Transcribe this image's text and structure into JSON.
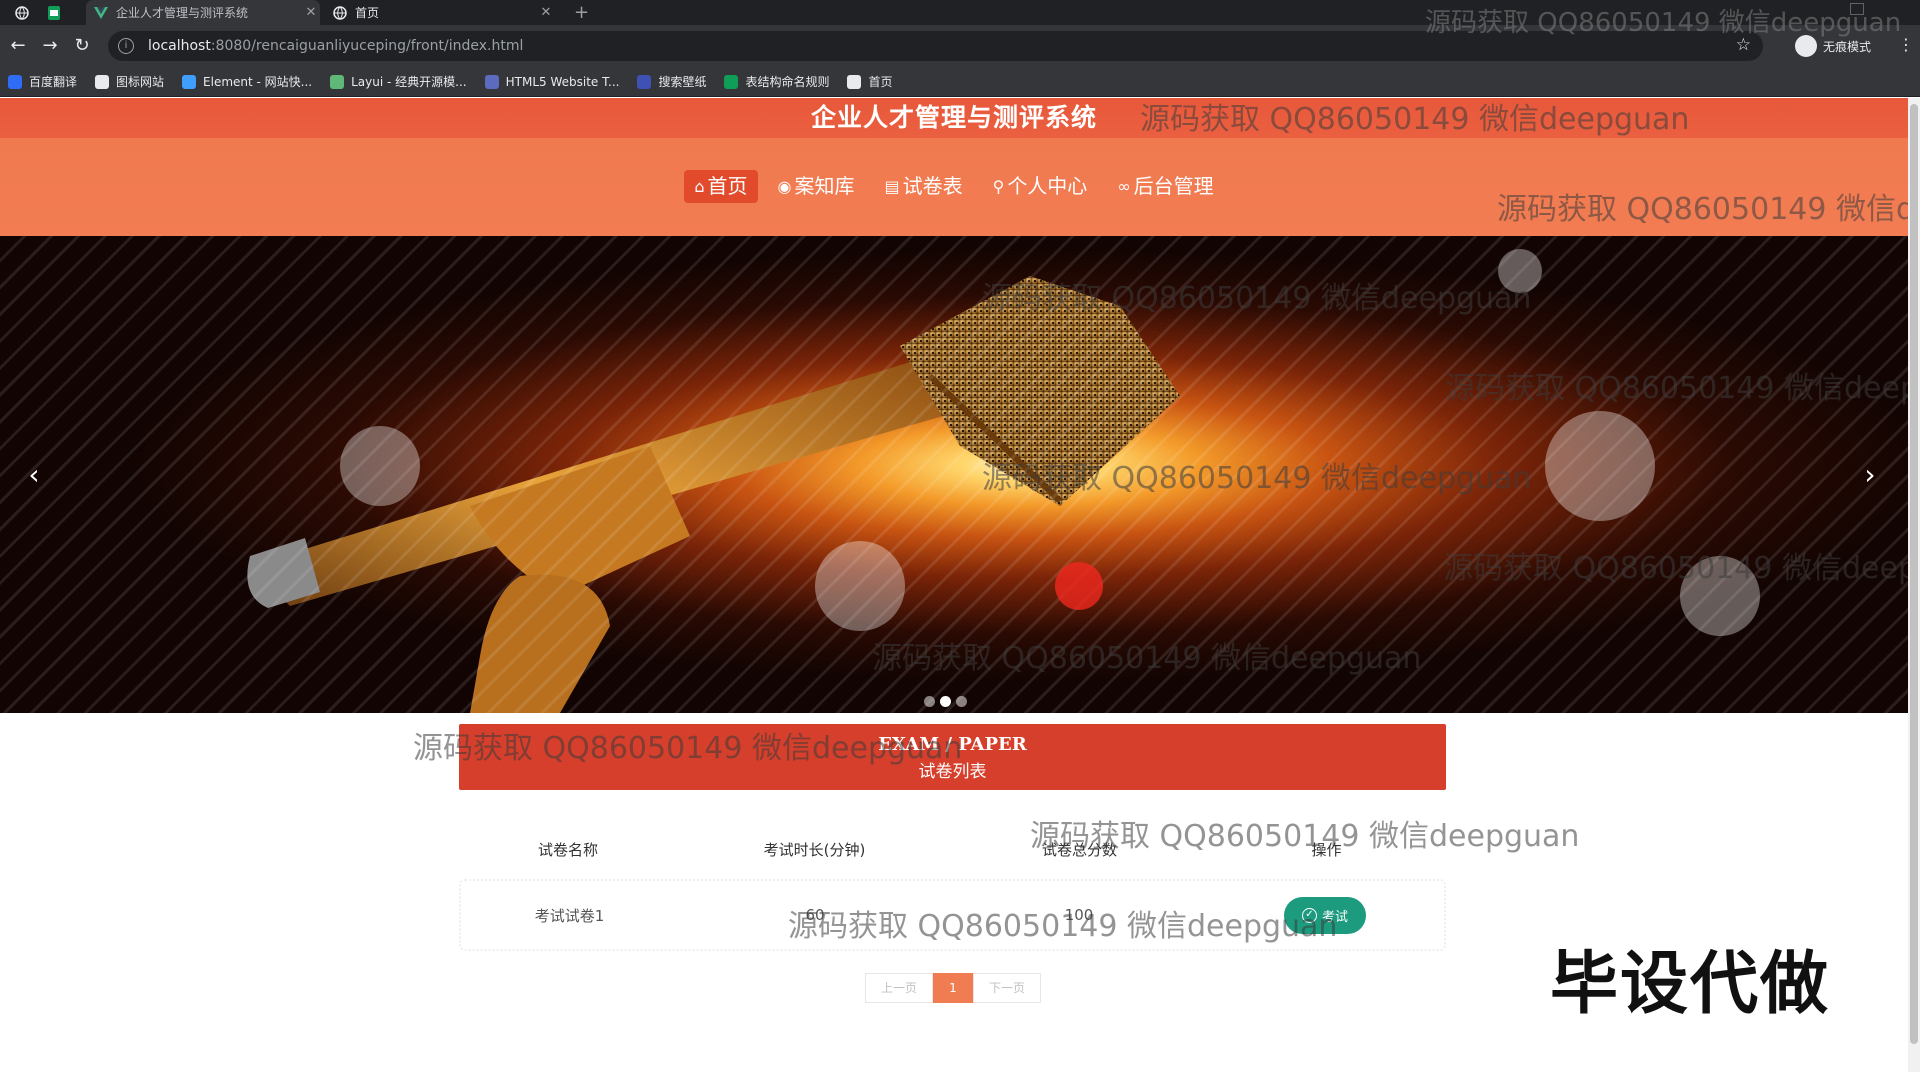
{
  "browser": {
    "tabs": [
      {
        "label": ""
      },
      {
        "label": ""
      },
      {
        "label": "企业人才管理与测评系统"
      },
      {
        "label": "首页"
      }
    ],
    "url_host": "localhost",
    "url_path": ":8080/rencaiguanliyuceping/front/index.html",
    "incognito_label": "无痕模式",
    "bookmarks": [
      {
        "label": "百度翻译",
        "color": "#2f6df6"
      },
      {
        "label": "图标网站",
        "color": "#e8eaed"
      },
      {
        "label": "Element - 网站快...",
        "color": "#409eff"
      },
      {
        "label": "Layui - 经典开源模...",
        "color": "#5fb878"
      },
      {
        "label": "HTML5 Website T...",
        "color": "#5c6bc0"
      },
      {
        "label": "搜索壁纸",
        "color": "#3f51b5"
      },
      {
        "label": "表结构命名规则",
        "color": "#0f9d58"
      },
      {
        "label": "首页",
        "color": "#e8eaed"
      }
    ]
  },
  "header": {
    "title": "企业人才管理与测评系统",
    "nav": [
      {
        "icon": "home-icon",
        "glyph": "⌂",
        "label": "首页",
        "active": true
      },
      {
        "icon": "globe-icon",
        "glyph": "◉",
        "label": "案知库",
        "active": false
      },
      {
        "icon": "paper-icon",
        "glyph": "▤",
        "label": "试卷表",
        "active": false
      },
      {
        "icon": "user-icon",
        "glyph": "⚲",
        "label": "个人中心",
        "active": false
      },
      {
        "icon": "link-icon",
        "glyph": "∞",
        "label": "后台管理",
        "active": false
      }
    ]
  },
  "carousel": {
    "prev": "‹",
    "next": "›",
    "slide_count": 3,
    "active_index": 1
  },
  "exam_section": {
    "title_en": "EXAM / PAPER",
    "title_zh": "试卷列表",
    "columns": [
      "试卷名称",
      "考试时长(分钟)",
      "试卷总分数",
      "操作"
    ],
    "rows": [
      {
        "name": "考试试卷1",
        "duration": "60",
        "total": "100",
        "action": "考试"
      }
    ]
  },
  "pagination": {
    "prev": "上一页",
    "current": "1",
    "next": "下一页"
  },
  "overlay": {
    "watermark_text": "源码获取 QQ86050149 微信deepguan",
    "stamp_text": "毕设代做"
  },
  "colors": {
    "header_top": "#e8583a",
    "header_nav": "#f37c52",
    "nav_active": "#e24a2c",
    "section_head": "#d63f2b",
    "exam_button": "#1c9b7e",
    "pager_current": "#f07c52"
  }
}
